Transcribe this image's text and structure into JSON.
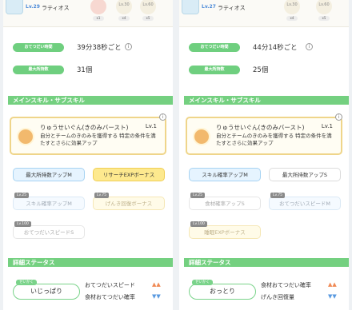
{
  "left": {
    "header": {
      "level": "Lv.29",
      "name": "ラティオス",
      "ingredient_levels": [
        "Lv.30",
        "Lv.60"
      ],
      "ingredient_counts": [
        "x1",
        "x4",
        "x5"
      ]
    },
    "help_interval": {
      "label": "おてつだい時間",
      "value": "39分38秒ごと"
    },
    "max_carry": {
      "label": "最大所持数",
      "value": "31個"
    },
    "section_skill": "メインスキル・サブスキル",
    "main_skill": {
      "name": "りゅうせいぐん(きのみバースト)",
      "level": "Lv.1",
      "desc": "自分とチームのきのみを獲得する 特定の条件を満たすとさらに効果アップ"
    },
    "subskills": [
      {
        "label": "最大所持数アップM",
        "lv": ""
      },
      {
        "label": "リサーチEXPボーナス",
        "lv": ""
      },
      {
        "label": "スキル確率アップM",
        "lv": "Lv.25"
      },
      {
        "label": "げんき回復ボーナス",
        "lv": "Lv.75"
      },
      {
        "label": "おてつだいスピードS",
        "lv": "Lv.100"
      }
    ],
    "section_detail": "詳細ステータス",
    "nature_tag": "せいかく",
    "nature": "いじっぱり",
    "effects": [
      {
        "label": "おてつだいスピード",
        "arrows": "▲▲"
      },
      {
        "label": "食材おてつだい確率",
        "arrows": "▼▼"
      }
    ]
  },
  "right": {
    "header": {
      "level": "Lv.27",
      "name": "ラティオス",
      "ingredient_levels": [
        "Lv.30",
        "Lv.60"
      ],
      "ingredient_counts": [
        "x1",
        "x4",
        "x5"
      ]
    },
    "help_interval": {
      "label": "おてつだい時間",
      "value": "44分14秒ごと"
    },
    "max_carry": {
      "label": "最大所持数",
      "value": "25個"
    },
    "section_skill": "メインスキル・サブスキル",
    "main_skill": {
      "name": "りゅうせいぐん(きのみバースト)",
      "level": "Lv.1",
      "desc": "自分とチームのきのみを獲得する 特定の条件を満たすとさらに効果アップ"
    },
    "subskills": [
      {
        "label": "スキル確率アップM",
        "lv": ""
      },
      {
        "label": "最大所持数アップS",
        "lv": ""
      },
      {
        "label": "食材確率アップS",
        "lv": "Lv.25"
      },
      {
        "label": "おてつだいスピードM",
        "lv": "Lv.75"
      },
      {
        "label": "睡眠EXPボーナス",
        "lv": "Lv.100"
      }
    ],
    "section_detail": "詳細ステータス",
    "nature_tag": "せいかく",
    "nature": "おっとり",
    "effects": [
      {
        "label": "食材おてつだい確率",
        "arrows": "▲▲"
      },
      {
        "label": "げんき回復量",
        "arrows": "▼▼"
      }
    ]
  },
  "info_icon": "i"
}
